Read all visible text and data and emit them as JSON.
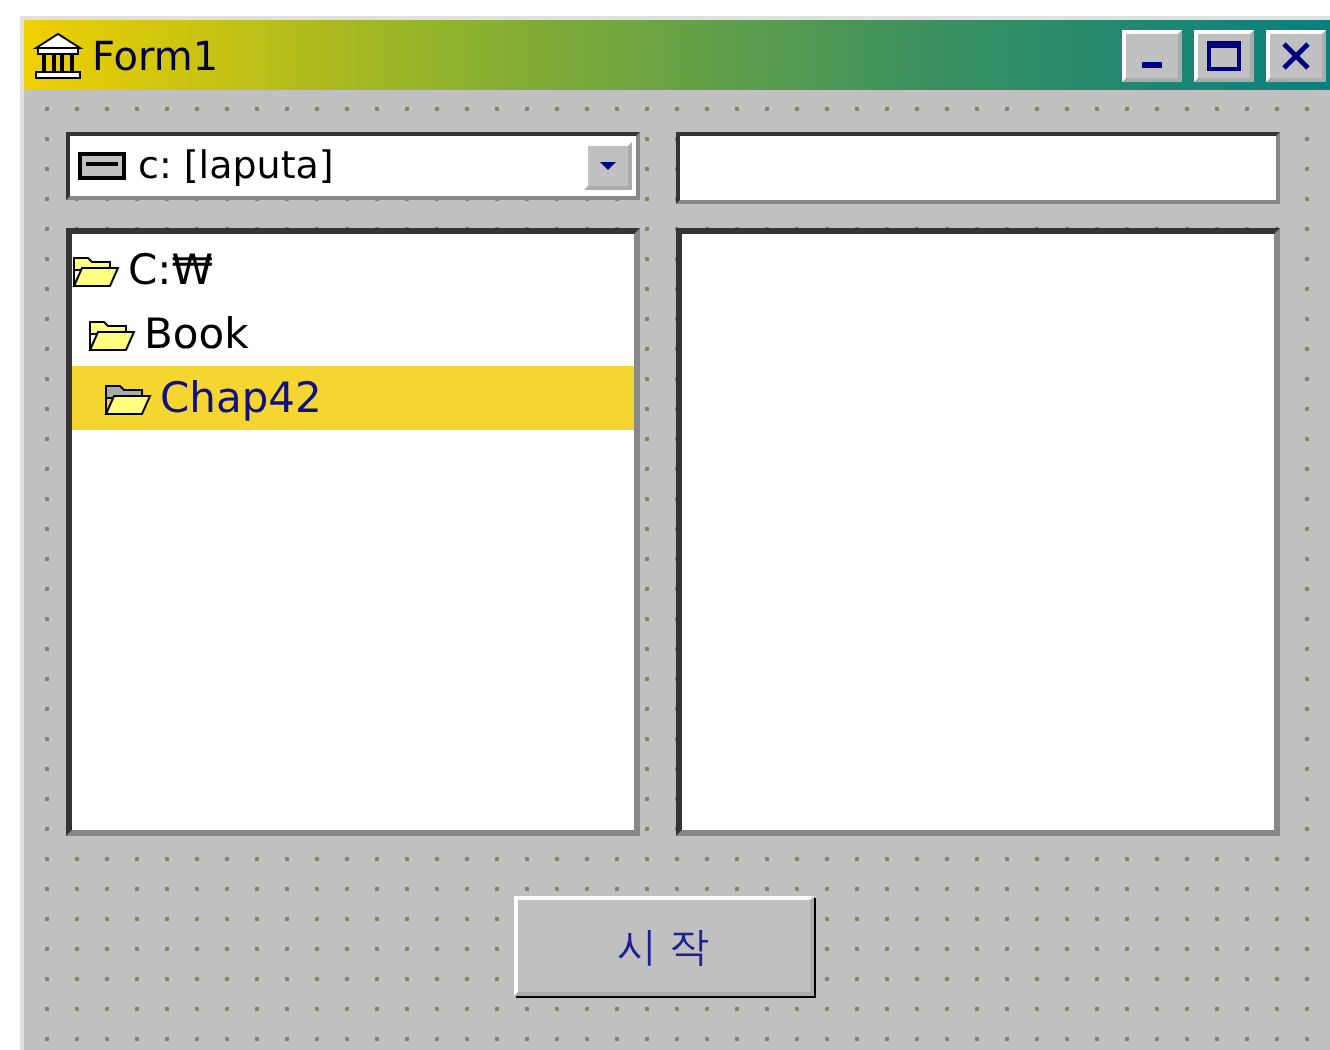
{
  "window": {
    "title": "Form1"
  },
  "drive_combo": {
    "value": "c: [laputa]"
  },
  "directory_tree": [
    {
      "label": "C:₩",
      "selected": false,
      "children": [
        {
          "label": "Book",
          "selected": false,
          "children": [
            {
              "label": "Chap42",
              "selected": true
            }
          ]
        }
      ]
    }
  ],
  "start_button": {
    "label": "시 작"
  }
}
